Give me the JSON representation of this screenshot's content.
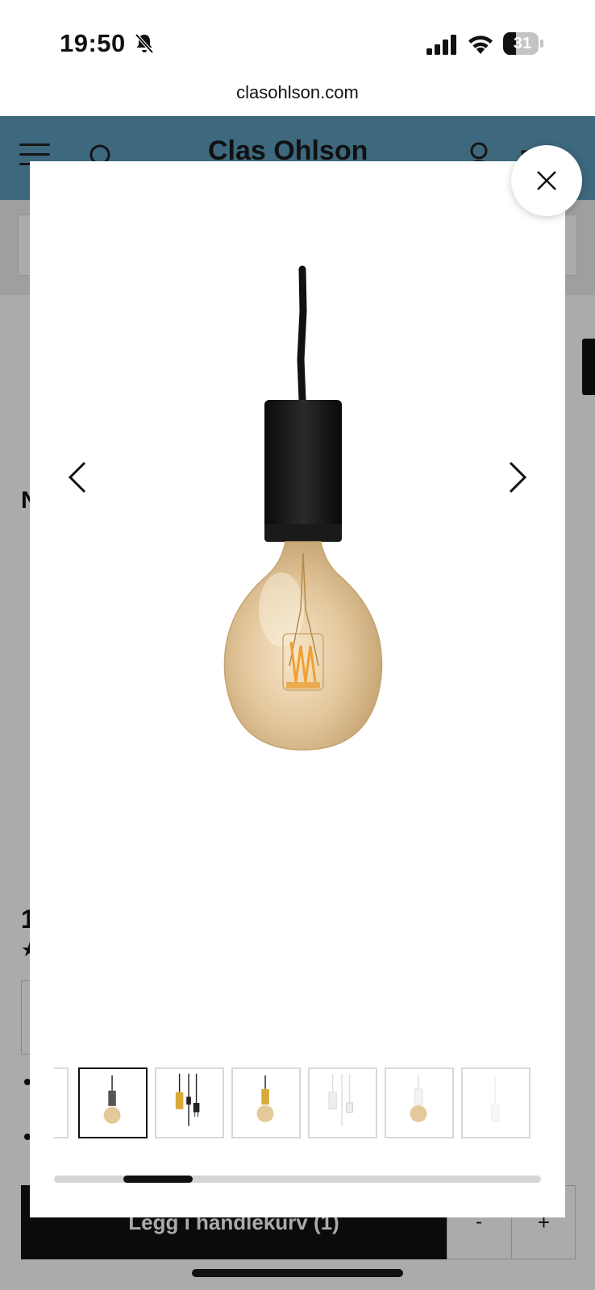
{
  "status_bar": {
    "time": "19:50",
    "battery": "31",
    "icons": [
      "bell-slash-icon",
      "signal-icon",
      "wifi-icon",
      "battery-icon"
    ]
  },
  "browser": {
    "url": "clasohlson.com"
  },
  "header": {
    "brand": "Clas Ohlson",
    "icons": [
      "hamburger-menu-icon",
      "search-icon",
      "account-icon",
      "cart-icon"
    ],
    "color": "#5b9cbb"
  },
  "page": {
    "heading_fragment": "N",
    "price_fragment": "1",
    "add_to_cart_label": "Legg i handlekurv (1)",
    "qty_minus": "-",
    "qty_plus": "+"
  },
  "gallery": {
    "main_image": "pendant-lamp-black-globe-bulb",
    "prev_icon": "chevron-left-icon",
    "next_icon": "chevron-right-icon",
    "close_icon": "close-icon",
    "thumbnails": [
      {
        "name": "thumb-partial",
        "variant": "white",
        "active": false
      },
      {
        "name": "thumb-1",
        "variant": "black-globe",
        "active": true
      },
      {
        "name": "thumb-2",
        "variant": "brass-cord-plug",
        "active": false
      },
      {
        "name": "thumb-3",
        "variant": "brass-globe",
        "active": false
      },
      {
        "name": "thumb-4",
        "variant": "white-cord-plug",
        "active": false
      },
      {
        "name": "thumb-5",
        "variant": "white-globe",
        "active": false
      },
      {
        "name": "thumb-6",
        "variant": "white-faint",
        "active": false
      }
    ],
    "scroll_position": 0.14
  }
}
